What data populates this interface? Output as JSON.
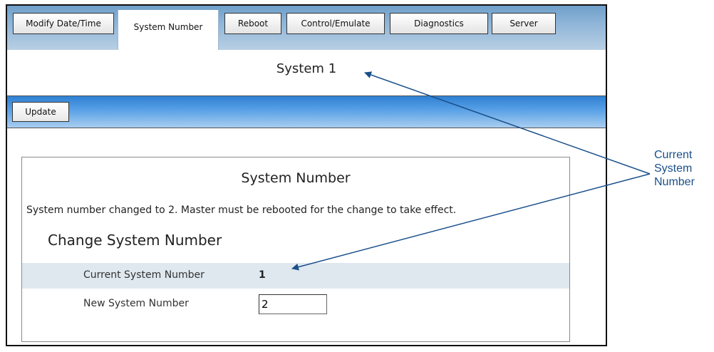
{
  "tabs": [
    {
      "label": "Modify Date/Time",
      "active": false
    },
    {
      "label": "System Number",
      "active": true
    },
    {
      "label": "Reboot",
      "active": false
    },
    {
      "label": "Control/Emulate",
      "active": false
    },
    {
      "label": "Diagnostics",
      "active": false
    },
    {
      "label": "Server",
      "active": false
    }
  ],
  "page": {
    "title": "System 1"
  },
  "toolbar": {
    "update_label": "Update"
  },
  "panel": {
    "title": "System Number",
    "message": "System number changed to 2. Master must be rebooted for the change to take effect.",
    "section_title": "Change System Number",
    "current_label": "Current System Number",
    "current_value": "1",
    "new_label": "New System Number",
    "new_value": "2"
  },
  "callout": {
    "line1": "Current",
    "line2": "System",
    "line3": "Number",
    "color": "#1a4f8a"
  }
}
